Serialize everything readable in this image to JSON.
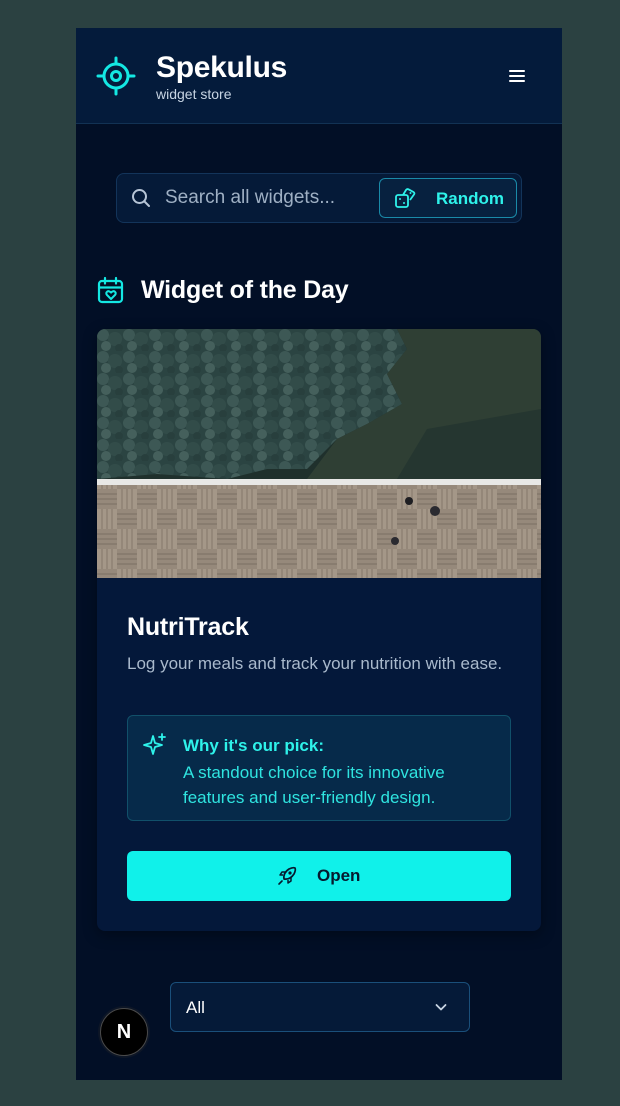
{
  "header": {
    "title": "Spekulus",
    "subtitle": "widget store",
    "logo_icon": "target-gear-icon",
    "menu_icon": "hamburger-menu-icon"
  },
  "search": {
    "placeholder": "Search all widgets...",
    "value": "",
    "icon": "search-icon",
    "random_label": "Random",
    "random_icon": "dice-icon"
  },
  "section": {
    "title": "Widget of the Day",
    "icon": "calendar-heart-icon"
  },
  "widget": {
    "name": "NutriTrack",
    "description": "Log your meals and track your nutrition with ease.",
    "image": "aerial-photo-boardwalk-water",
    "pick_title": "Why it's our pick:",
    "pick_text": "A standout choice for its innovative features and user-friendly design.",
    "pick_icon": "sparkles-icon",
    "open_label": "Open",
    "open_icon": "rocket-icon"
  },
  "filter": {
    "selected": "All",
    "icon": "chevron-down-icon"
  },
  "badge": {
    "letter": "N"
  },
  "colors": {
    "page_background": "#2b4141",
    "app_background": "#020f26",
    "header_background": "#041b3b",
    "card_background": "#04183a",
    "accent": "#10f1ea",
    "accent_text": "#2ef2ea",
    "pick_box_background": "#062a4a"
  }
}
